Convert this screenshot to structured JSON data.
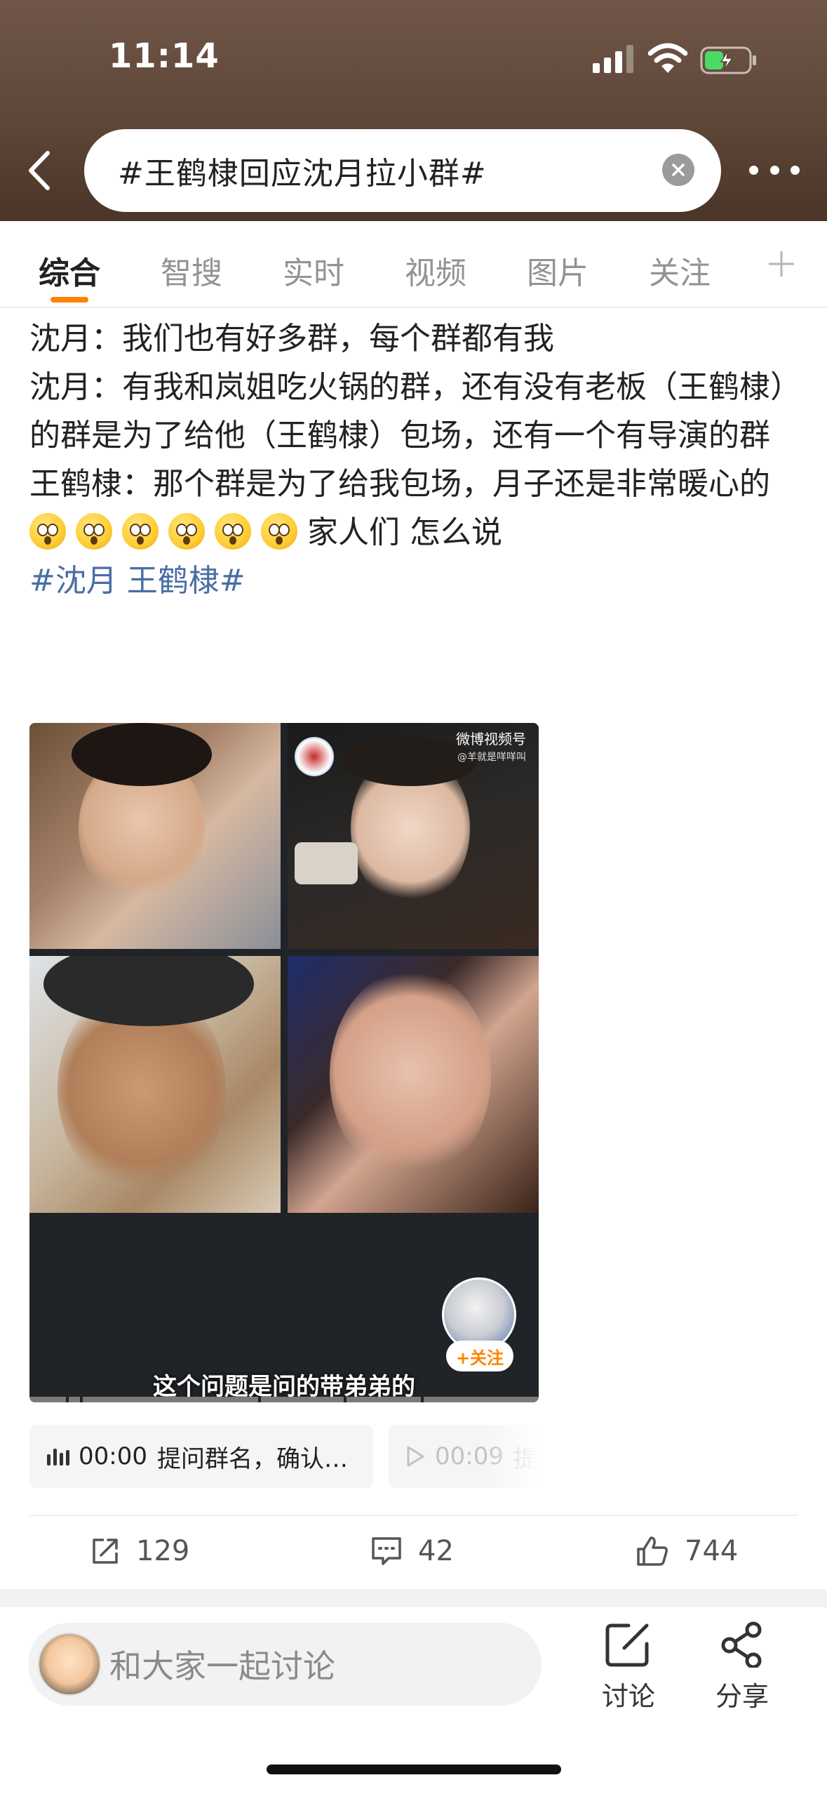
{
  "status_bar": {
    "time": "11:14"
  },
  "header": {
    "search_text": "#王鹤棣回应沈月拉小群#"
  },
  "tabs": [
    {
      "label": "综合",
      "active": true
    },
    {
      "label": "智搜"
    },
    {
      "label": "实时"
    },
    {
      "label": "视频"
    },
    {
      "label": "图片"
    },
    {
      "label": "关注"
    }
  ],
  "post": {
    "lines": [
      "沈月：我们也有好多群，每个群都有我",
      "沈月：有我和岚姐吃火锅的群，还有没有老板（王鹤棣）的群是为了给他（王鹤棣）包场，还有一个有导演的群",
      "王鹤棣：那个群是为了给我包场，月子还是非常暖心的"
    ],
    "emoji_line_text": "家人们 怎么说",
    "emoji_count": 6,
    "emoji_name": "surprised-face-emoji",
    "hashtag": "#沈月 王鹤棣#"
  },
  "video": {
    "watermark": "微博视频号",
    "watermark_sub": "@羊就是咩咩叫",
    "follow_label": "+关注",
    "subtitle": "这个问题是问的带弟弟的"
  },
  "chapters": [
    {
      "time": "00:00",
      "title": "提问群名，确认…"
    },
    {
      "time": "00:09",
      "title": "提"
    }
  ],
  "actions": {
    "share_count": "129",
    "comment_count": "42",
    "like_count": "744"
  },
  "bottom_bar": {
    "comment_placeholder": "和大家一起讨论",
    "discuss_label": "讨论",
    "share_label": "分享"
  },
  "colors": {
    "header_bg": "#5e4638",
    "accent": "#ff8200",
    "hashtag": "#4a6ea4"
  }
}
